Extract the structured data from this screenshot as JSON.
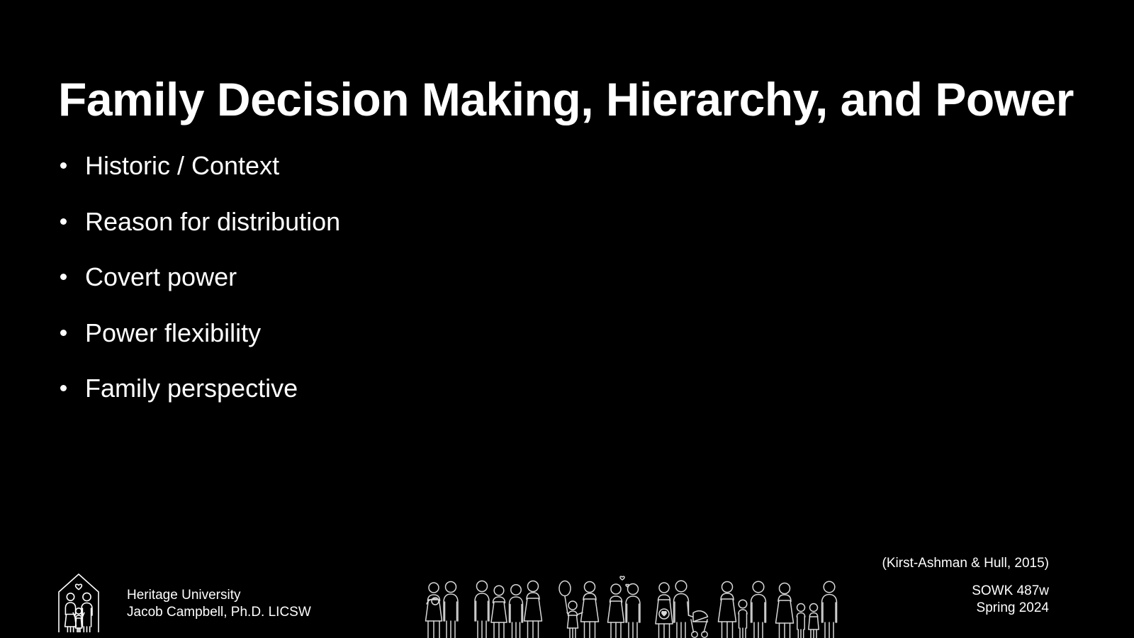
{
  "slide": {
    "background_color": "#000000",
    "text_color": "#ffffff",
    "title": "Family Decision Making, Hierarchy, and Power"
  },
  "content": {
    "bullets": [
      {
        "label": "Historic / Context"
      },
      {
        "label": "Reason for distribution"
      },
      {
        "label": "Covert power"
      },
      {
        "label": "Power flexibility"
      },
      {
        "label": "Family perspective"
      }
    ]
  },
  "footer": {
    "logo_icon": "house-family-logo-icon",
    "institution": "Heritage University",
    "presenter": "Jacob Campbell, Ph.D. LICSW",
    "citation": "(Kirst-Ashman & Hull, 2015)",
    "course_code": "SOWK 487w",
    "term": "Spring 2024",
    "illustration_icon": "family-pictogram-row-icon"
  }
}
